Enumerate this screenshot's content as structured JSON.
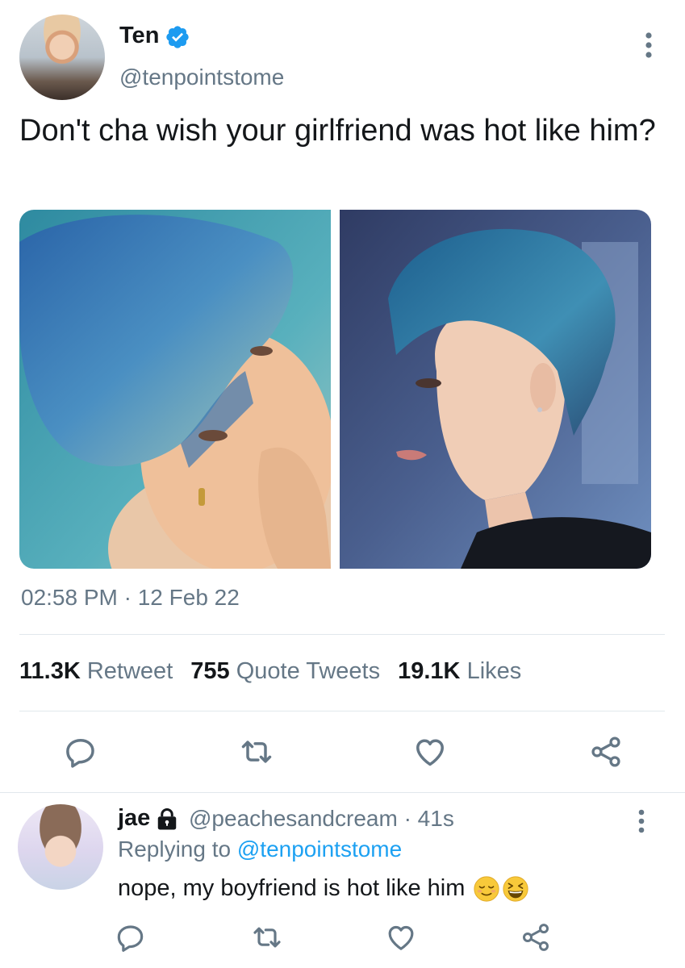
{
  "tweet": {
    "author_name": "Ten",
    "author_handle": "@tenpointstome",
    "verified": true,
    "text": "Don't cha wish your girlfriend was hot like him?",
    "timestamp": "02:58 PM · 12 Feb 22",
    "stats": {
      "retweets_count": "11.3K",
      "retweets_label": "Retweet",
      "quotes_count": "755",
      "quotes_label": "Quote Tweets",
      "likes_count": "19.1K",
      "likes_label": "Likes"
    },
    "actions": [
      "reply-icon",
      "retweet-icon",
      "like-icon",
      "share-icon"
    ]
  },
  "reply": {
    "author_name": "jae",
    "protected": true,
    "handle_time": "@peachesandcream · 41s",
    "replying_prefix": "Replying to",
    "replying_to": "@tenpointstome",
    "text": "nope, my boyfriend is hot like him",
    "emojis": [
      "relieved-face-emoji",
      "grinning-squinting-face-emoji"
    ],
    "actions": [
      "reply-icon",
      "retweet-icon",
      "like-icon",
      "share-icon"
    ]
  },
  "colors": {
    "primary_text": "#14171a",
    "secondary_text": "#657786",
    "link": "#1da1f2",
    "verified_badge": "#1d9bf0",
    "divider": "#e1e8ed"
  }
}
